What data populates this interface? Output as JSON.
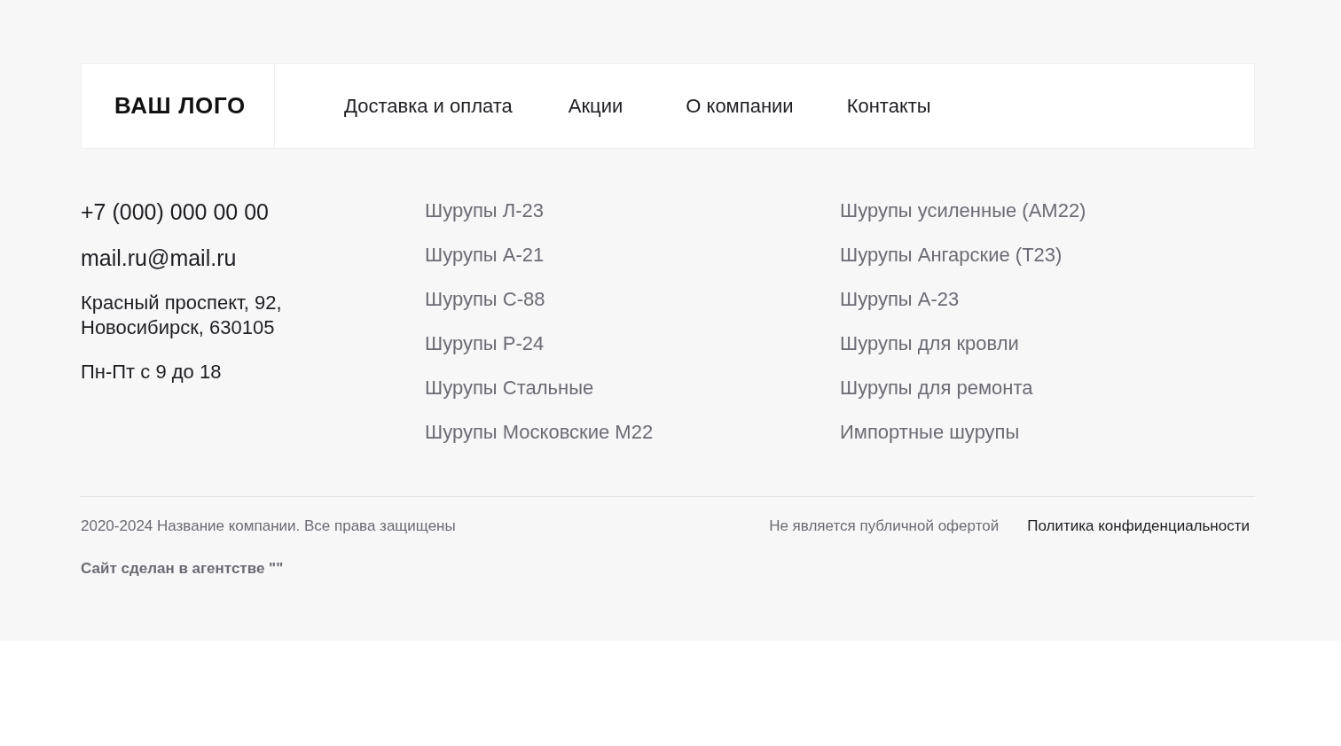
{
  "header": {
    "logo": "ВАШ ЛОГО",
    "nav": [
      {
        "label": "Доставка и оплата"
      },
      {
        "label": "Акции"
      },
      {
        "label": "О компании"
      },
      {
        "label": "Контакты"
      }
    ]
  },
  "contacts": {
    "phone": "+7 (000) 000 00 00",
    "email": "mail.ru@mail.ru",
    "address_lines": [
      "Красный проспект, 92,",
      "Новосибирск, 630105"
    ],
    "hours": "Пн-Пт с 9 до 18"
  },
  "catalog_columns": [
    [
      "Шурупы Л-23",
      "Шурупы А-21",
      "Шурупы С-88",
      "Шурупы Р-24",
      "Шурупы Стальные",
      "Шурупы Московские М22"
    ],
    [
      "Шурупы усиленные (АМ22)",
      "Шурупы Ангарские (Т23)",
      "Шурупы А-23",
      "Шурупы для кровли",
      "Шурупы для ремонта",
      "Импортные шурупы"
    ]
  ],
  "footer": {
    "copyright": "2020-2024 Название компании. Все права защищены",
    "links": [
      {
        "label": "Не является публичной офертой",
        "kind": "muted"
      },
      {
        "label": "Политика конфиденциальности",
        "kind": "strong"
      }
    ],
    "made_by": "Сайт сделан в агентстве \"\""
  }
}
